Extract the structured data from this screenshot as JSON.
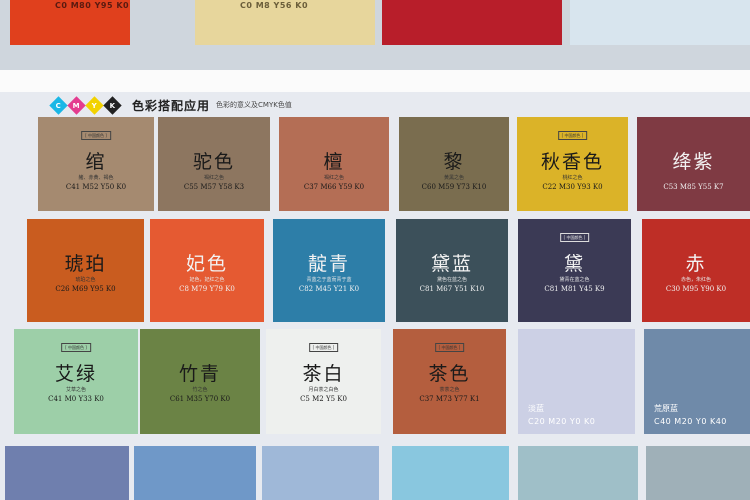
{
  "top_strip": {
    "swatches": [
      {
        "code": "C0 M80 Y95 K0",
        "color": "#e0401d"
      },
      {
        "code": "C0 M8 Y56 K0",
        "color": "#e7d69c"
      },
      {
        "code": "",
        "color": "#b81e2a"
      },
      {
        "code": "",
        "color": "#d8e5ee"
      }
    ]
  },
  "legend": {
    "letters": [
      "C",
      "M",
      "Y",
      "K"
    ],
    "letter_colors": [
      "#1ab7e6",
      "#e43c8f",
      "#f2d200",
      "#222222"
    ],
    "title": "色彩搭配应用",
    "subtitle": "色彩的意义及CMYK色值"
  },
  "swatches": [
    {
      "name": "绾",
      "badge": "[ 中国颜色 ]",
      "desc": "赭、赤黄、褐色",
      "code": "C41 M52 Y50 K0",
      "color": "#a58a70"
    },
    {
      "name": "驼色",
      "badge": "",
      "desc": "褐红之色",
      "code": "C55 M57 Y58 K3",
      "color": "#8d7660"
    },
    {
      "name": "檀",
      "badge": "",
      "desc": "褐红之色",
      "code": "C37 M66 Y59 K0",
      "color": "#b46e55"
    },
    {
      "name": "黎",
      "badge": "",
      "desc": "黄黑之色",
      "code": "C60 M59 Y73 K10",
      "color": "#7a6d4f"
    },
    {
      "name": "秋香色",
      "badge": "[ 中国颜色 ]",
      "desc": "桃红之色",
      "code": "C22 M30 Y93 K0",
      "color": "#dbb328"
    },
    {
      "name": "绛紫",
      "badge": "",
      "desc": "",
      "code": "C53 M85 Y55 K7",
      "color": "#7f3a43"
    },
    {
      "name": "琥珀",
      "badge": "",
      "desc": "琥珀之色",
      "code": "C26 M69 Y95 K0",
      "color": "#c95c1f"
    },
    {
      "name": "妃色",
      "badge": "",
      "desc": "妃色，妃红之色",
      "code": "C8 M79 Y79 K0",
      "color": "#e55a32"
    },
    {
      "name": "靛青",
      "badge": "",
      "desc": "青蓝之于蓝而青于蓝",
      "code": "C82 M45 Y21 K0",
      "color": "#2d7ea8"
    },
    {
      "name": "黛蓝",
      "badge": "",
      "desc": "黛色在蓝之色",
      "code": "C81 M67 Y51 K10",
      "color": "#3c505a"
    },
    {
      "name": "黛",
      "badge": "[ 中国颜色 ]",
      "desc": "黛青在蓝之色",
      "code": "C81 M81 Y45 K9",
      "color": "#3b3a55"
    },
    {
      "name": "赤",
      "badge": "",
      "desc": "赤色，朱红色",
      "code": "C30 M95 Y90 K0",
      "color": "#be2e26"
    },
    {
      "name": "艾绿",
      "badge": "[ 中国颜色 ]",
      "desc": "艾草之色",
      "code": "C41 M0 Y33 K0",
      "color": "#9dcfa8"
    },
    {
      "name": "竹青",
      "badge": "",
      "desc": "竹之色",
      "code": "C61 M35 Y70 K0",
      "color": "#6b8345"
    },
    {
      "name": "茶白",
      "badge": "[ 中国颜色 ]",
      "desc": "月白茶之白色",
      "code": "C5 M2 Y5 K0",
      "color": "#eef0ee"
    },
    {
      "name": "茶色",
      "badge": "[ 中国颜色 ]",
      "desc": "茶茶之色",
      "code": "C37 M73 Y77 K1",
      "color": "#b45e3e"
    },
    {
      "name": "淡蓝",
      "badge": "",
      "desc": "",
      "code": "C20 M20 Y0 K0",
      "color": "#ccd0e5"
    },
    {
      "name": "荒原蓝",
      "badge": "",
      "desc": "",
      "code": "C40 M20 Y0 K40",
      "color": "#6f8aa9"
    },
    {
      "name": "",
      "badge": "",
      "desc": "",
      "code": "",
      "color": "#6f7fae"
    },
    {
      "name": "",
      "badge": "",
      "desc": "",
      "code": "",
      "color": "#6f98c8"
    },
    {
      "name": "",
      "badge": "",
      "desc": "",
      "code": "",
      "color": "#9fb8d8"
    },
    {
      "name": "",
      "badge": "",
      "desc": "",
      "code": "",
      "color": "#89c7df"
    },
    {
      "name": "",
      "badge": "",
      "desc": "",
      "code": "",
      "color": "#9fbfc8"
    },
    {
      "name": "",
      "badge": "",
      "desc": "",
      "code": "",
      "color": "#9fb0b8"
    }
  ]
}
